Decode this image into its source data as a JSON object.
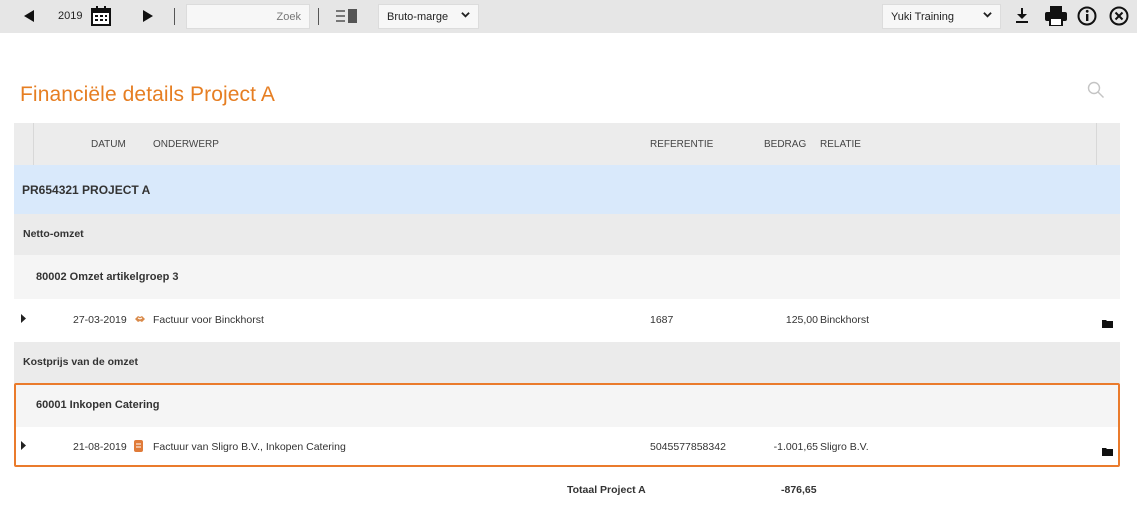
{
  "toolbar": {
    "year": "2019",
    "search_button": "Zoek",
    "report_select": "Bruto-marge",
    "admin_select": "Yuki Training"
  },
  "page": {
    "title": "Financiële details Project A"
  },
  "table": {
    "headers": {
      "datum": "DATUM",
      "onderwerp": "ONDERWERP",
      "referentie": "REFERENTIE",
      "bedrag": "BEDRAG",
      "relatie": "RELATIE"
    },
    "project": "PR654321 PROJECT A",
    "groups": [
      {
        "label": "Netto-omzet",
        "accounts": [
          {
            "label": "80002 Omzet artikelgroep 3",
            "lines": [
              {
                "datum": "27-03-2019",
                "icon": "sales-invoice-icon",
                "onderwerp": "Factuur voor Binckhorst",
                "referentie": "1687",
                "bedrag": "125,00",
                "relatie": "Binckhorst"
              }
            ]
          }
        ]
      },
      {
        "label": "Kostprijs van de omzet",
        "accounts": [
          {
            "label": "60001 Inkopen Catering",
            "lines": [
              {
                "datum": "21-08-2019",
                "icon": "purchase-invoice-icon",
                "onderwerp": "Factuur van Sligro B.V., Inkopen Catering",
                "referentie": "5045577858342",
                "bedrag": "-1.001,65",
                "relatie": "Sligro B.V."
              }
            ]
          }
        ]
      }
    ],
    "total_label": "Totaal Project A",
    "total_amount": "-876,65"
  },
  "colors": {
    "accent": "#e67e22",
    "highlight_border": "#ea7b2c",
    "project_row": "#d9e9fb"
  }
}
